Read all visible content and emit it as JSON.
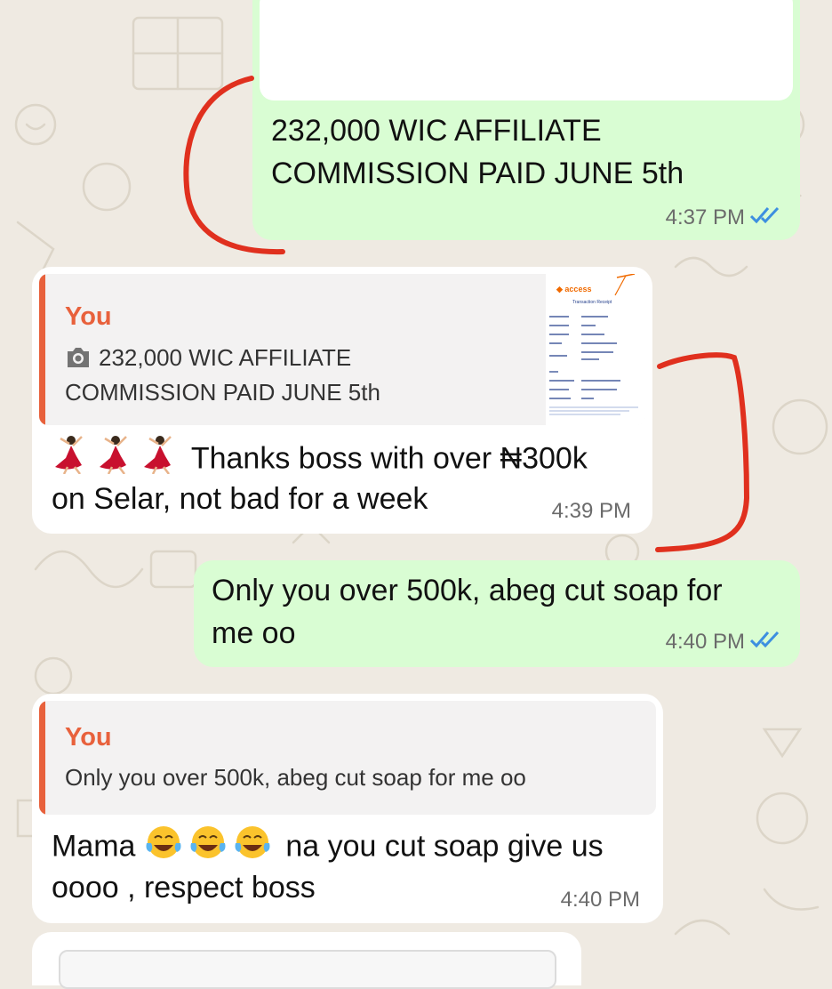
{
  "messages": [
    {
      "id": "m1",
      "direction": "outgoing",
      "text_lines": [
        "232,000 WIC AFFILIATE",
        "COMMISSION PAID JUNE 5th"
      ],
      "time": "4:37 PM",
      "status": "read"
    },
    {
      "id": "m2",
      "direction": "incoming",
      "quote": {
        "author": "You",
        "camera_icon": "camera-icon",
        "text_lines": [
          "232,000 WIC AFFILIATE",
          "COMMISSION PAID JUNE 5th"
        ],
        "thumbnail": "transaction-receipt-thumbnail"
      },
      "emoji": "dancer-emoji",
      "text_line1": "Thanks boss with over ₦300k",
      "text_line2": "on Selar, not bad for a week",
      "time": "4:39 PM"
    },
    {
      "id": "m3",
      "direction": "outgoing",
      "text_lines": [
        "Only you over 500k, abeg cut soap for",
        "me oo"
      ],
      "time": "4:40 PM",
      "status": "read"
    },
    {
      "id": "m4",
      "direction": "incoming",
      "quote": {
        "author": "You",
        "text": "Only you over 500k, abeg cut soap for me oo"
      },
      "text_start": "Mama",
      "emoji": "tears-of-joy-emoji",
      "text_line1_end": "na you cut soap give us",
      "text_line2": "oooo , respect boss",
      "time": "4:40 PM"
    }
  ],
  "colors": {
    "outgoing_bubble": "#d9fdd3",
    "incoming_bubble": "#ffffff",
    "quote_accent": "#e8613c",
    "read_ticks": "#3d8fe0",
    "annotation": "#e0301e",
    "wallpaper": "#efeae2"
  }
}
